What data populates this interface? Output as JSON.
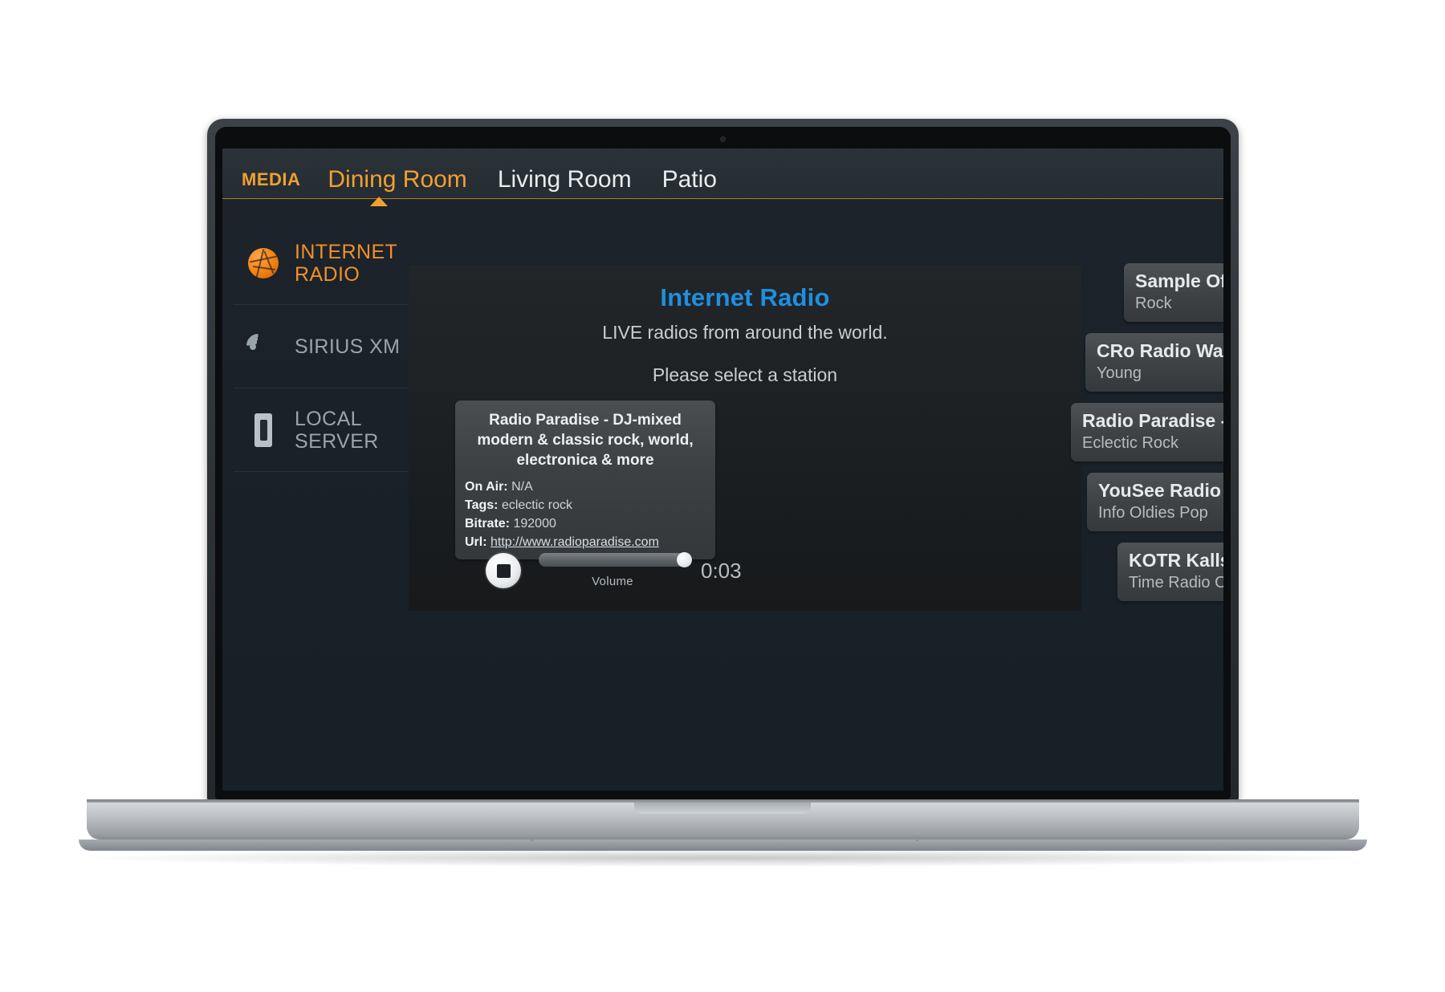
{
  "header": {
    "brand": "MEDIA",
    "tabs": [
      {
        "label": "Dining Room",
        "active": true
      },
      {
        "label": "Living Room",
        "active": false
      },
      {
        "label": "Patio",
        "active": false
      }
    ]
  },
  "sidebar": {
    "items": [
      {
        "label_line1": "INTERNET",
        "label_line2": "RADIO",
        "icon": "globe-icon",
        "active": true
      },
      {
        "label_line1": "SIRIUS XM",
        "label_line2": "",
        "icon": "broadcast-waves-icon",
        "active": false
      },
      {
        "label_line1": "LOCAL",
        "label_line2": "SERVER",
        "icon": "server-icon",
        "active": false
      }
    ]
  },
  "panel": {
    "title": "Internet Radio",
    "subtitle": "LIVE radios from around the world.",
    "hint": "Please select a station",
    "now_playing": {
      "title": "Radio Paradise - DJ-mixed modern & classic rock, world, electronica & more",
      "on_air_label": "On Air:",
      "on_air_value": "N/A",
      "tags_label": "Tags:",
      "tags_value": "eclectic rock",
      "bitrate_label": "Bitrate:",
      "bitrate_value": "192000",
      "url_label": "Url:",
      "url_value": "http://www.radioparadise.com"
    },
    "player": {
      "stop_icon": "stop-icon",
      "volume_label": "Volume",
      "volume_percent": 100,
      "elapsed_time": "0:03"
    }
  },
  "station_list": [
    {
      "name": "Sample Offline",
      "genre": "Rock"
    },
    {
      "name": "CRo Radio Wave",
      "genre": "Young"
    },
    {
      "name": "Radio Paradise - D...",
      "genre": "Eclectic Rock"
    },
    {
      "name": "YouSee Radio Fro...",
      "genre": "Info Oldies Pop"
    },
    {
      "name": "KOTR Kallsign S",
      "genre": "Time Radio Old"
    }
  ],
  "colors": {
    "accent_orange": "#f0a030",
    "title_blue": "#1f8fe0",
    "panel_bg": "#1f2326",
    "app_bg": "#1a2128"
  }
}
